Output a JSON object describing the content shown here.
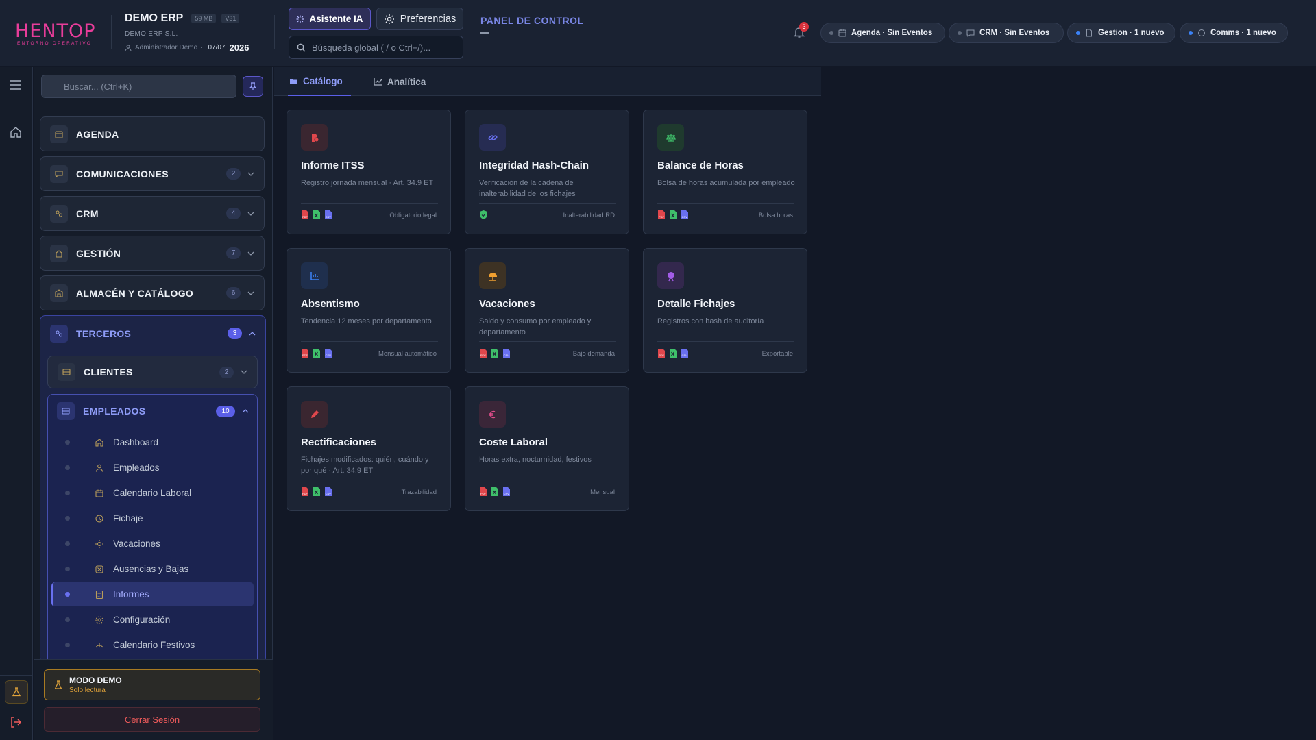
{
  "header": {
    "logo_text": "HENTOP",
    "logo_subtitle": "ENTORNO OPERATIVO",
    "company": "DEMO ERP",
    "size_chip": "59 MB",
    "version_chip": "V31",
    "company_legal": "DEMO ERP S.L.",
    "user": "Administrador Demo",
    "date": "07/07",
    "year": "2026",
    "ai_button": "Asistente IA",
    "prefs_button": "Preferencias",
    "search_placeholder": "Búsqueda global ( / o Ctrl+/)...",
    "panel_title": "PANEL DE CONTROL",
    "notifications_count": "3",
    "pills": [
      {
        "label": "Agenda · Sin Eventos",
        "status": "idle"
      },
      {
        "label": "CRM · Sin Eventos",
        "status": "idle"
      },
      {
        "label": "Gestion · 1 nuevo",
        "status": "new"
      },
      {
        "label": "Comms · 1 nuevo",
        "status": "new"
      }
    ]
  },
  "sidebar": {
    "search_placeholder": "Buscar... (Ctrl+K)",
    "groups": [
      {
        "label": "AGENDA",
        "count": ""
      },
      {
        "label": "COMUNICACIONES",
        "count": "2"
      },
      {
        "label": "CRM",
        "count": "4"
      },
      {
        "label": "GESTIÓN",
        "count": "7"
      },
      {
        "label": "ALMACÉN Y CATÁLOGO",
        "count": "6"
      }
    ],
    "terceros": {
      "label": "TERCEROS",
      "count": "3"
    },
    "clientes": {
      "label": "CLIENTES",
      "count": "2"
    },
    "empleados": {
      "label": "EMPLEADOS",
      "count": "10"
    },
    "items": [
      {
        "label": "Dashboard"
      },
      {
        "label": "Empleados"
      },
      {
        "label": "Calendario Laboral"
      },
      {
        "label": "Fichaje"
      },
      {
        "label": "Vacaciones"
      },
      {
        "label": "Ausencias y Bajas"
      },
      {
        "label": "Informes"
      },
      {
        "label": "Configuración"
      },
      {
        "label": "Calendario Festivos"
      }
    ],
    "demo_title": "MODO DEMO",
    "demo_subtitle": "Solo lectura",
    "logout": "Cerrar Sesión"
  },
  "main": {
    "tabs": [
      {
        "label": "Catálogo",
        "active": true
      },
      {
        "label": "Analítica",
        "active": false
      }
    ],
    "cards": [
      {
        "name": "Informe ITSS",
        "desc": "Registro jornada mensual · Art. 34.9 ET",
        "tag": "Obligatorio legal",
        "icon": "document-icon",
        "icon_color": "#e0474c",
        "icon_bg": "#3a2630",
        "formats": [
          "pdf",
          "xls",
          "csv"
        ]
      },
      {
        "name": "Integridad Hash-Chain",
        "desc": "Verificación de la cadena de inalterabilidad de los fichajes",
        "tag": "Inalterabilidad RD",
        "icon": "link-icon",
        "icon_color": "#6970f0",
        "icon_bg": "#262c52",
        "formats": [
          "shield"
        ]
      },
      {
        "name": "Balance de Horas",
        "desc": "Bolsa de horas acumulada por empleado",
        "tag": "Bolsa horas",
        "icon": "scale-icon",
        "icon_color": "#3fbf6a",
        "icon_bg": "#1f3a2e",
        "formats": [
          "pdf",
          "xls",
          "csv"
        ]
      },
      {
        "name": "Absentismo",
        "desc": "Tendencia 12 meses por departamento",
        "tag": "Mensual automático",
        "icon": "chart-icon",
        "icon_color": "#3b82f6",
        "icon_bg": "#1f2f4d",
        "formats": [
          "pdf",
          "xls",
          "csv"
        ]
      },
      {
        "name": "Vacaciones",
        "desc": "Saldo y consumo por empleado y departamento",
        "tag": "Bajo demanda",
        "icon": "umbrella-icon",
        "icon_color": "#f0a030",
        "icon_bg": "#3d3224",
        "formats": [
          "pdf",
          "xls",
          "csv"
        ]
      },
      {
        "name": "Detalle Fichajes",
        "desc": "Registros con hash de auditoría",
        "tag": "Exportable",
        "icon": "fingerprint-icon",
        "icon_color": "#a35ce8",
        "icon_bg": "#33284d",
        "formats": [
          "pdf",
          "xls",
          "csv"
        ]
      },
      {
        "name": "Rectificaciones",
        "desc": "Fichajes modificados: quién, cuándo y por qué · Art. 34.9 ET",
        "tag": "Trazabilidad",
        "icon": "pencil-icon",
        "icon_color": "#e0474c",
        "icon_bg": "#3a2630",
        "formats": [
          "pdf",
          "xls",
          "csv"
        ]
      },
      {
        "name": "Coste Laboral",
        "desc": "Horas extra, nocturnidad, festivos",
        "tag": "Mensual",
        "icon": "euro-icon",
        "icon_color": "#e04c8a",
        "icon_bg": "#3a2638",
        "formats": [
          "pdf",
          "xls",
          "csv"
        ]
      }
    ]
  },
  "colors": {
    "accent": "#5b5fe8",
    "brand": "#e83d9a",
    "pdf": "#e0474c",
    "xls": "#3fbf6a",
    "csv": "#6970f0",
    "warning": "#e2a43a",
    "danger": "#ef5b5b"
  }
}
